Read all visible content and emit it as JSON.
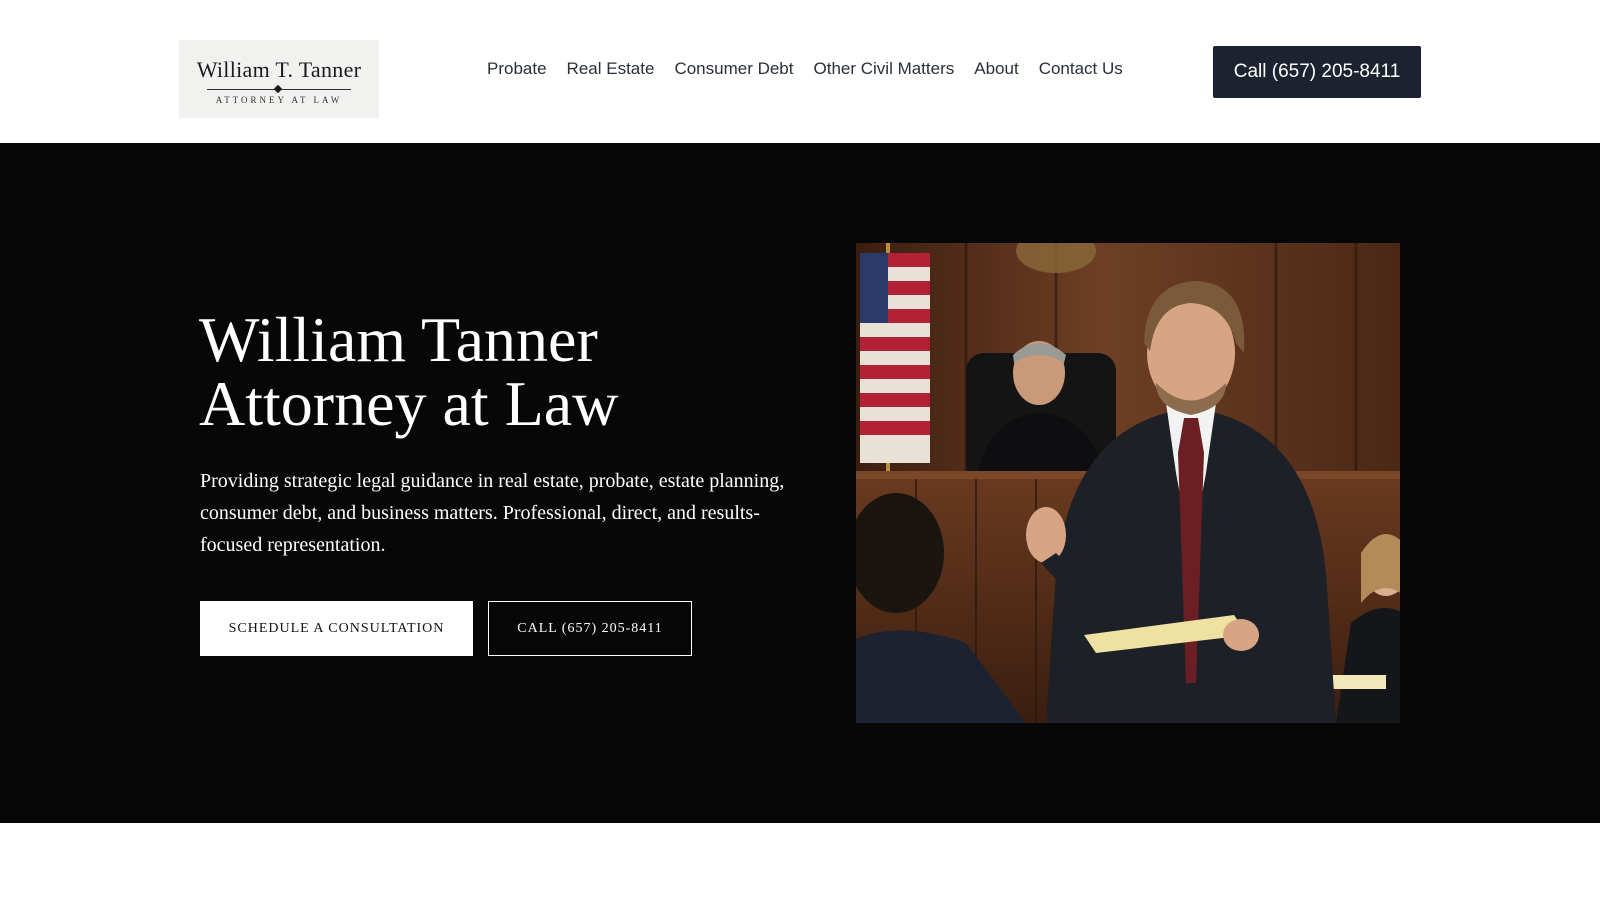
{
  "header": {
    "logo": {
      "name": "William T. Tanner",
      "subtitle": "ATTORNEY AT LAW"
    },
    "nav": [
      {
        "label": "Probate"
      },
      {
        "label": "Real Estate"
      },
      {
        "label": "Consumer Debt"
      },
      {
        "label": "Other Civil Matters"
      },
      {
        "label": "About"
      },
      {
        "label": "Contact Us"
      }
    ],
    "call_button": "Call (657) 205-8411"
  },
  "hero": {
    "title_line1": "William Tanner",
    "title_line2": "Attorney at Law",
    "description": "Providing strategic legal guidance in real estate, probate, estate planning, consumer debt, and business matters. Professional, direct, and results-focused representation.",
    "primary_button": "SCHEDULE A CONSULTATION",
    "secondary_button": "CALL (657) 205-8411",
    "image": {
      "subject": "attorney-in-courtroom-photo"
    }
  },
  "colors": {
    "hero_background": "#070708",
    "call_button_background": "#1c2230",
    "header_background": "#ffffff"
  }
}
